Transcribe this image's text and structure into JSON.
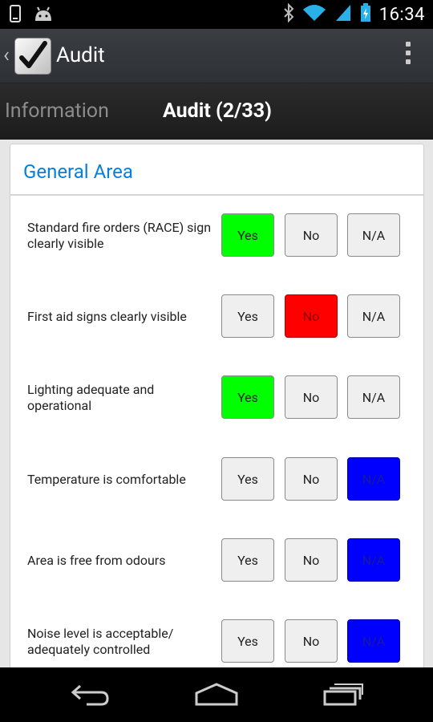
{
  "status_bar": {
    "time": "16:34",
    "icons": [
      "phone-icon",
      "android-icon",
      "bluetooth-icon",
      "wifi-icon",
      "signal-icon",
      "battery-icon"
    ]
  },
  "action_bar": {
    "title": "Audit",
    "icons": [
      "back-chevron-icon",
      "app-logo-checkmark-icon",
      "overflow-menu-icon"
    ]
  },
  "tabs": [
    {
      "label": "Information",
      "active": false
    },
    {
      "label": "Audit (2/33)",
      "active": true
    }
  ],
  "section": {
    "title": "General Area",
    "items": [
      {
        "label": "Standard fire orders (RACE) sign clearly visible",
        "yes": "Yes",
        "no": "No",
        "na": "N/A",
        "selected": "yes"
      },
      {
        "label": "First aid signs clearly visible",
        "yes": "Yes",
        "no": "No",
        "na": "N/A",
        "selected": "no"
      },
      {
        "label": "Lighting adequate and operational",
        "yes": "Yes",
        "no": "No",
        "na": "N/A",
        "selected": "yes"
      },
      {
        "label": "Temperature is comfortable",
        "yes": "Yes",
        "no": "No",
        "na": "N/A",
        "selected": "na"
      },
      {
        "label": "Area is free from odours",
        "yes": "Yes",
        "no": "No",
        "na": "N/A",
        "selected": "na"
      },
      {
        "label": "Noise level is acceptable/ adequately controlled",
        "yes": "Yes",
        "no": "No",
        "na": "N/A",
        "selected": "na"
      }
    ]
  },
  "colors": {
    "yes_selected": "#00ff00",
    "no_selected": "#ff0000",
    "na_selected": "#0000ff",
    "accent": "#0a7fd8"
  },
  "nav_bar": {
    "icons": [
      "back-nav-icon",
      "home-nav-icon",
      "recent-apps-icon"
    ]
  }
}
